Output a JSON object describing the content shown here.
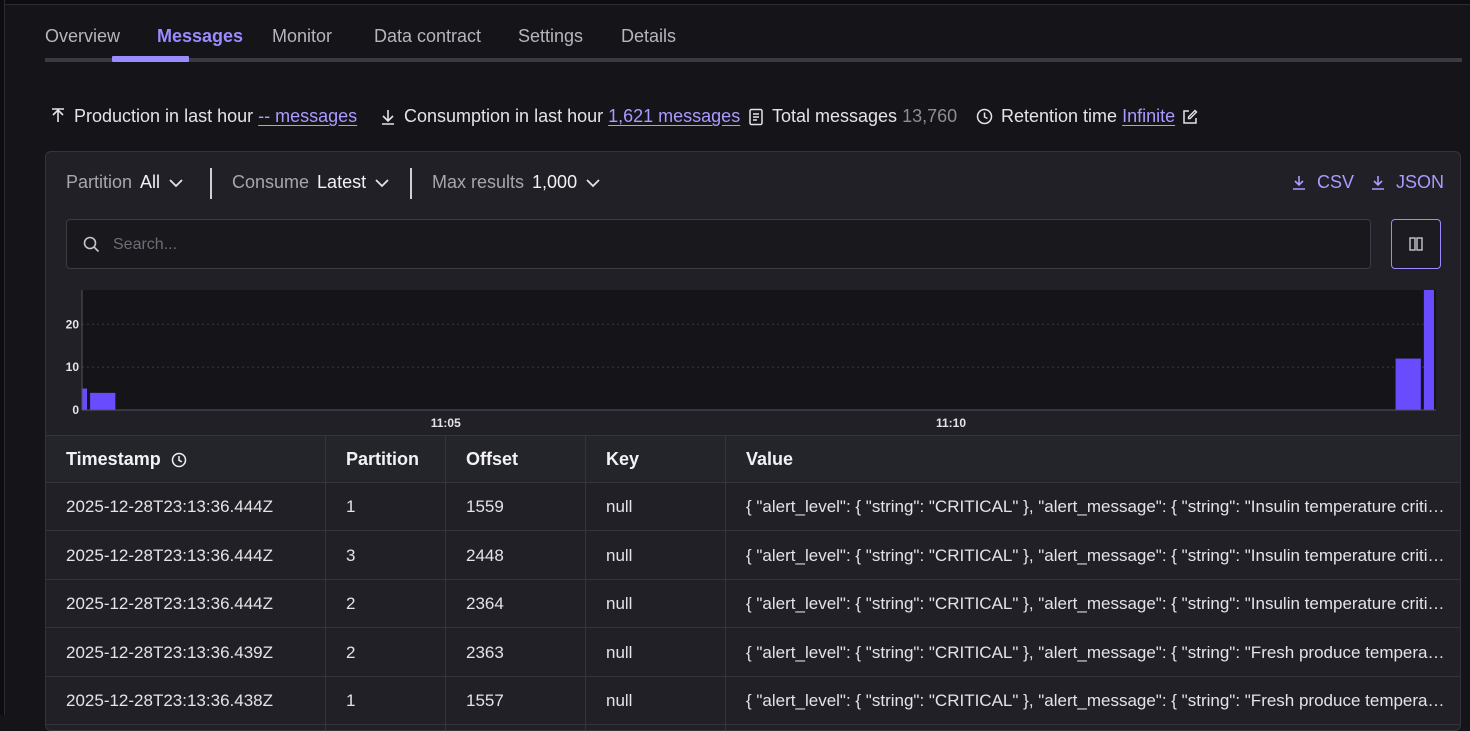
{
  "tabs": [
    {
      "label": "Overview",
      "active": false
    },
    {
      "label": "Messages",
      "active": true
    },
    {
      "label": "Monitor",
      "active": false
    },
    {
      "label": "Data contract",
      "active": false
    },
    {
      "label": "Settings",
      "active": false
    },
    {
      "label": "Details",
      "active": false
    }
  ],
  "stats": {
    "production_label": "Production in last hour",
    "production_value": "-- messages",
    "consumption_label": "Consumption in last hour",
    "consumption_value": "1,621 messages",
    "total_label": "Total messages",
    "total_value": "13,760",
    "retention_label": "Retention time",
    "retention_value": "Infinite"
  },
  "filters": {
    "partition_label": "Partition",
    "partition_value": "All",
    "consume_label": "Consume",
    "consume_value": "Latest",
    "max_label": "Max results",
    "max_value": "1,000"
  },
  "downloads": {
    "csv": "CSV",
    "json": "JSON"
  },
  "search": {
    "placeholder": "Search..."
  },
  "accent_color": "#9a8bff",
  "chart_data": {
    "type": "bar",
    "y_ticks": [
      "20",
      "10",
      "0"
    ],
    "ylim": [
      0,
      28
    ],
    "x_ticks": [
      "11:05",
      "11:10"
    ],
    "bars": [
      {
        "minute": 0.0,
        "width": 0.05,
        "value": 5
      },
      {
        "minute": 0.08,
        "width": 0.25,
        "value": 4
      },
      {
        "minute": 13.0,
        "width": 0.25,
        "value": 12
      },
      {
        "minute": 13.28,
        "width": 0.1,
        "value": 28
      }
    ],
    "x_range_minutes": [
      0,
      13.4
    ],
    "x_tick_minutes": [
      3.6,
      8.6
    ],
    "grid": true
  },
  "table": {
    "columns": [
      "Timestamp",
      "Partition",
      "Offset",
      "Key",
      "Value"
    ],
    "rows": [
      [
        "2025-12-28T23:13:36.444Z",
        "1",
        "1559",
        "null",
        "{ \"alert_level\": { \"string\": \"CRITICAL\" }, \"alert_message\": { \"string\": \"Insulin temperature critical\" },..."
      ],
      [
        "2025-12-28T23:13:36.444Z",
        "3",
        "2448",
        "null",
        "{ \"alert_level\": { \"string\": \"CRITICAL\" }, \"alert_message\": { \"string\": \"Insulin temperature critical\" },..."
      ],
      [
        "2025-12-28T23:13:36.444Z",
        "2",
        "2364",
        "null",
        "{ \"alert_level\": { \"string\": \"CRITICAL\" }, \"alert_message\": { \"string\": \"Insulin temperature critical\" },..."
      ],
      [
        "2025-12-28T23:13:36.439Z",
        "2",
        "2363",
        "null",
        "{ \"alert_level\": { \"string\": \"CRITICAL\" }, \"alert_message\": { \"string\": \"Fresh produce temperature h..."
      ],
      [
        "2025-12-28T23:13:36.438Z",
        "1",
        "1557",
        "null",
        "{ \"alert_level\": { \"string\": \"CRITICAL\" }, \"alert_message\": { \"string\": \"Fresh produce temperature h..."
      ]
    ]
  }
}
